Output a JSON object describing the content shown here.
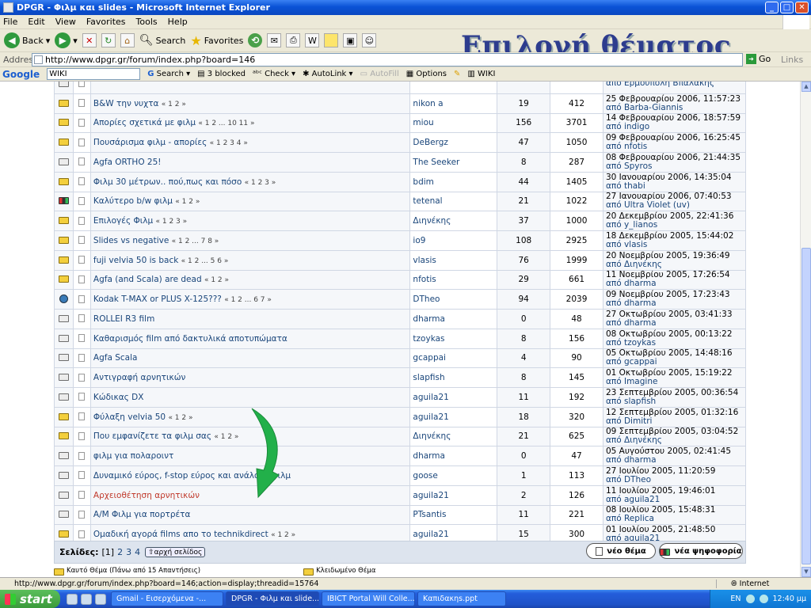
{
  "window": {
    "title": "DPGR - Φιλμ και slides - Microsoft Internet Explorer"
  },
  "menu": [
    "File",
    "Edit",
    "View",
    "Favorites",
    "Tools",
    "Help"
  ],
  "toolbar": {
    "back": "Back",
    "search": "Search",
    "favorites": "Favorites"
  },
  "overlay_title": "Επιλογή θέματος",
  "address": {
    "label": "Address",
    "url": "http://www.dpgr.gr/forum/index.php?board=146",
    "go": "Go",
    "links": "Links"
  },
  "google": {
    "logo": "Google",
    "query": "WIKI",
    "search": "Search",
    "blocked": "3 blocked",
    "check": "Check",
    "autolink": "AutoLink",
    "autofill": "AutoFill",
    "options": "Options",
    "wiki": "WIKI"
  },
  "topics": [
    {
      "icon": "normal",
      "subject": "",
      "pages": "",
      "author": "",
      "replies": "",
      "views": "",
      "last_date": "",
      "last_by": "από Ερμούπολη Βπαλάκης"
    },
    {
      "icon": "hot",
      "subject": "B&W την νυχτα",
      "pages": "« 1 2 »",
      "author": "nikon a",
      "replies": "19",
      "views": "412",
      "last_date": "25 Φεβρουαρίου 2006, 11:57:23",
      "last_by": "από Barba-Giannis"
    },
    {
      "icon": "hot",
      "subject": "Απορίες σχετικά με φιλμ",
      "pages": "« 1 2 ... 10 11 »",
      "author": "miou",
      "replies": "156",
      "views": "3701",
      "last_date": "14 Φεβρουαρίου 2006, 18:57:59",
      "last_by": "από indigo"
    },
    {
      "icon": "hot",
      "subject": "Πουσάρισμα φιλμ - απορίες",
      "pages": "« 1 2 3 4 »",
      "author": "DeBergz",
      "replies": "47",
      "views": "1050",
      "last_date": "09 Φεβρουαρίου 2006, 16:25:45",
      "last_by": "από nfotis"
    },
    {
      "icon": "normal",
      "subject": "Agfa ORTHO 25!",
      "pages": "",
      "author": "The Seeker",
      "replies": "8",
      "views": "287",
      "last_date": "08 Φεβρουαρίου 2006, 21:44:35",
      "last_by": "από Spyros"
    },
    {
      "icon": "hot",
      "subject": "Φιλμ 30 μέτρων.. πού,πως και πόσο",
      "pages": "« 1 2 3 »",
      "author": "bdim",
      "replies": "44",
      "views": "1405",
      "last_date": "30 Ιανουαρίου 2006, 14:35:04",
      "last_by": "από thabi"
    },
    {
      "icon": "poll",
      "subject": "Καλύτερο b/w φιλμ",
      "pages": "« 1 2 »",
      "author": "tetenal",
      "replies": "21",
      "views": "1022",
      "last_date": "27 Ιανουαρίου 2006, 07:40:53",
      "last_by": "από Ultra Violet (uv)"
    },
    {
      "icon": "hot",
      "subject": "Επιλογές Φιλμ",
      "pages": "« 1 2 3 »",
      "author": "Διηνέκης",
      "replies": "37",
      "views": "1000",
      "last_date": "20 Δεκεμβρίου 2005, 22:41:36",
      "last_by": "από y_lianos"
    },
    {
      "icon": "hot",
      "subject": "Slides vs negative",
      "pages": "« 1 2 ... 7 8 »",
      "author": "io9",
      "replies": "108",
      "views": "2925",
      "last_date": "18 Δεκεμβρίου 2005, 15:44:02",
      "last_by": "από vlasis"
    },
    {
      "icon": "hot",
      "subject": "fuji velvia 50 is back",
      "pages": "« 1 2 ... 5 6 »",
      "author": "vlasis",
      "replies": "76",
      "views": "1999",
      "last_date": "20 Νοεμβρίου 2005, 19:36:49",
      "last_by": "από Διηνέκης"
    },
    {
      "icon": "hot",
      "subject": "Agfa (and Scala) are dead",
      "pages": "« 1 2 »",
      "author": "nfotis",
      "replies": "29",
      "views": "661",
      "last_date": "11 Νοεμβρίου 2005, 17:26:54",
      "last_by": "από dharma"
    },
    {
      "icon": "globe",
      "subject": "Kodak T-MAX or PLUS X-125???",
      "pages": "« 1 2 ... 6 7 »",
      "author": "DTheo",
      "replies": "94",
      "views": "2039",
      "last_date": "09 Νοεμβρίου 2005, 17:23:43",
      "last_by": "από dharma"
    },
    {
      "icon": "normal",
      "subject": "ROLLEI R3 film",
      "pages": "",
      "author": "dharma",
      "replies": "0",
      "views": "48",
      "last_date": "27 Οκτωβρίου 2005, 03:41:33",
      "last_by": "από dharma"
    },
    {
      "icon": "normal",
      "subject": "Καθαρισμός film από δακτυλικά αποτυπώματα",
      "pages": "",
      "author": "tzoykas",
      "replies": "8",
      "views": "156",
      "last_date": "08 Οκτωβρίου 2005, 00:13:22",
      "last_by": "από tzoykas"
    },
    {
      "icon": "normal",
      "subject": "Agfa Scala",
      "pages": "",
      "author": "gcappai",
      "replies": "4",
      "views": "90",
      "last_date": "05 Οκτωβρίου 2005, 14:48:16",
      "last_by": "από gcappai"
    },
    {
      "icon": "normal",
      "subject": "Αντιγραφή αρνητικών",
      "pages": "",
      "author": "slapfish",
      "replies": "8",
      "views": "145",
      "last_date": "01 Οκτωβρίου 2005, 15:19:22",
      "last_by": "από Imagine"
    },
    {
      "icon": "normal",
      "subject": "Κώδικας DX",
      "pages": "",
      "author": "aguila21",
      "replies": "11",
      "views": "192",
      "last_date": "23 Σεπτεμβρίου 2005, 00:36:54",
      "last_by": "από slapfish"
    },
    {
      "icon": "hot",
      "subject": "Φύλαξη velvia 50",
      "pages": "« 1 2 »",
      "author": "aguila21",
      "replies": "18",
      "views": "320",
      "last_date": "12 Σεπτεμβρίου 2005, 01:32:16",
      "last_by": "από Dimitri"
    },
    {
      "icon": "hot",
      "subject": "Που εμφανίζετε τα φιλμ σας",
      "pages": "« 1 2 »",
      "author": "Διηνέκης",
      "replies": "21",
      "views": "625",
      "last_date": "09 Σεπτεμβρίου 2005, 03:04:52",
      "last_by": "από Διηνέκης"
    },
    {
      "icon": "normal",
      "subject": "φιλμ για πολαροιντ",
      "pages": "",
      "author": "dharma",
      "replies": "0",
      "views": "47",
      "last_date": "05 Αυγούστου 2005, 02:41:45",
      "last_by": "από dharma"
    },
    {
      "icon": "normal",
      "subject": "Δυναμικό εύρος, f-stop εύρος και ανάλογη φιλμ",
      "pages": "",
      "author": "goose",
      "replies": "1",
      "views": "113",
      "last_date": "27 Ιουλίου 2005, 11:20:59",
      "last_by": "από DTheo"
    },
    {
      "icon": "normal",
      "subject": "Αρχειοθέτηση αρνητικών",
      "pages": "",
      "author": "aguila21",
      "replies": "2",
      "views": "126",
      "last_date": "11 Ιουλίου 2005, 19:46:01",
      "last_by": "από aguila21",
      "highlight": true
    },
    {
      "icon": "normal",
      "subject": "Α/Μ Φιλμ για πορτρέτα",
      "pages": "",
      "author": "PTsantis",
      "replies": "11",
      "views": "221",
      "last_date": "08 Ιουλίου 2005, 15:48:31",
      "last_by": "από Replica"
    },
    {
      "icon": "hot",
      "subject": "Ομαδική αγορά films απο το technikdirect",
      "pages": "« 1 2 »",
      "author": "aguila21",
      "replies": "15",
      "views": "300",
      "last_date": "01 Ιουλίου 2005, 21:48:50",
      "last_by": "από aguila21"
    }
  ],
  "pagination": {
    "label": "Σελίδες:",
    "current": "[1]",
    "p2": "2",
    "p3": "3",
    "p4": "4",
    "home": "αρχή σελίδος"
  },
  "buttons": {
    "new_topic": "νέο θέμα",
    "new_poll": "νέα ψηφοφορία"
  },
  "legend": {
    "hot": "Καυτό Θέμα (Πάνω από 15 Απαντήσεις)",
    "locked": "Κλειδωμένο Θέμα"
  },
  "status": {
    "url": "http://www.dpgr.gr/forum/index.php?board=146;action=display;threadid=15764",
    "zone": "Internet"
  },
  "taskbar": {
    "start": "start",
    "tasks": [
      "Gmail - Εισερχόμενα -...",
      "DPGR - Φιλμ και slide...",
      "IBICT Portal Will Colle...",
      "Καπιδακηs.ppt"
    ],
    "lang": "EN",
    "clock": "12:40 μμ"
  },
  "colors": {
    "accent": "#0a52d6",
    "arrow": "#22b04a",
    "link": "#19457a",
    "highlight": "#c0392b"
  }
}
